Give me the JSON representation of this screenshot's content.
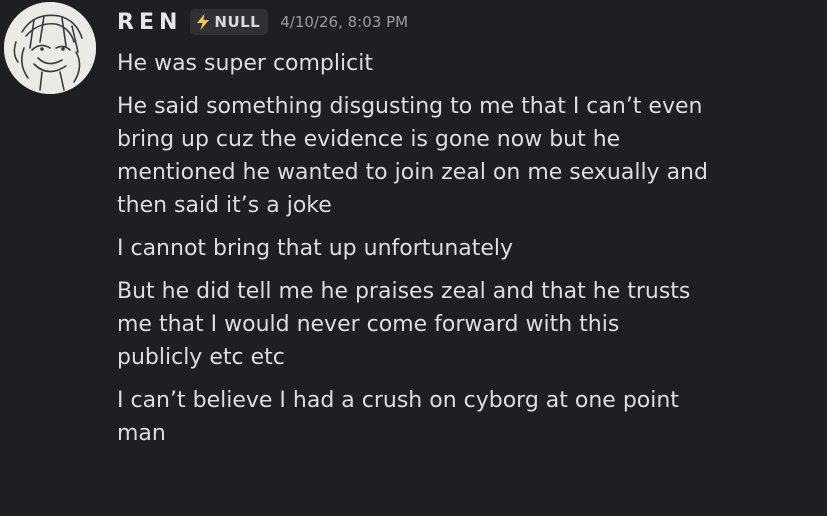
{
  "message": {
    "author": "REN",
    "tag": {
      "icon": "lightning-bolt-icon",
      "label": "NULL",
      "icon_color": "#f2c94c"
    },
    "timestamp": "4/10/26, 8:03 PM",
    "avatar": "avatar-sketch-drawing",
    "groups": [
      [
        "He was super complicit"
      ],
      [
        "He said something disgusting to me that I can’t even",
        "bring up cuz the evidence is gone now but he",
        "mentioned he wanted to join zeal on me sexually and",
        "then said it’s a joke"
      ],
      [
        "I cannot bring that up unfortunately"
      ],
      [
        "But he did tell me he praises zeal and that he trusts",
        "me that I would never come forward with this",
        "publicly etc etc"
      ],
      [
        "I can’t believe I had a crush on cyborg at one point",
        "man"
      ]
    ]
  },
  "colors": {
    "background": "#1e1f22",
    "text": "#dcdde0",
    "timestamp": "#9a9ca2",
    "tag_background": "#2f3136"
  }
}
